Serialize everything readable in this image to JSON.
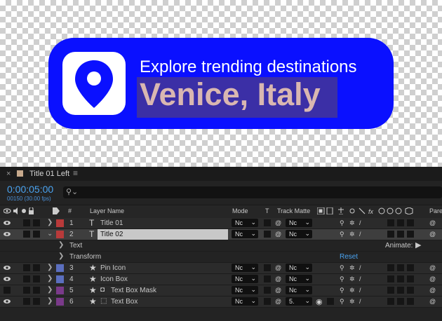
{
  "banner": {
    "subtitle": "Explore trending destinations",
    "title": "Venice, Italy",
    "bg_color": "#0a10ff",
    "title_color": "#d9b7b1"
  },
  "timeline": {
    "tab_title": "Title 01 Left",
    "timecode": "0:00:05:00",
    "frames": "00150 (30.00 fps)",
    "headers": {
      "hash": "#",
      "layer_name": "Layer Name",
      "mode": "Mode",
      "t": "T",
      "track_matte": "Track Matte",
      "parent": "Pare"
    },
    "layers": [
      {
        "num": "1",
        "name": "Title 01",
        "type_icon": "text-layer-icon",
        "label_color": "#b83a3a",
        "mode": "Nc",
        "matte": "Nc"
      },
      {
        "num": "2",
        "name": "Title 02",
        "type_icon": "text-layer-icon",
        "label_color": "#b83a3a",
        "mode": "Nc",
        "matte": "Nc"
      },
      {
        "num": "3",
        "name": "Pin Icon",
        "type_icon": "shape-layer-icon",
        "label_color": "#5b6fbf",
        "mode": "Nc",
        "matte": "Nc"
      },
      {
        "num": "4",
        "name": "Icon Box",
        "type_icon": "shape-layer-icon",
        "label_color": "#5b6fbf",
        "mode": "Nc",
        "matte": "Nc"
      },
      {
        "num": "5",
        "name": "Text Box Mask",
        "type_icon": "shape-layer-icon",
        "label_color": "#7a3a8a",
        "mode": "Nc",
        "matte": "Nc"
      },
      {
        "num": "6",
        "name": "Text Box",
        "type_icon": "shape-layer-icon",
        "label_color": "#7a3a8a",
        "mode": "Nc",
        "matte": "5."
      }
    ],
    "sub_props": {
      "text": "Text",
      "transform": "Transform",
      "animate": "Animate:",
      "reset": "Reset"
    }
  }
}
